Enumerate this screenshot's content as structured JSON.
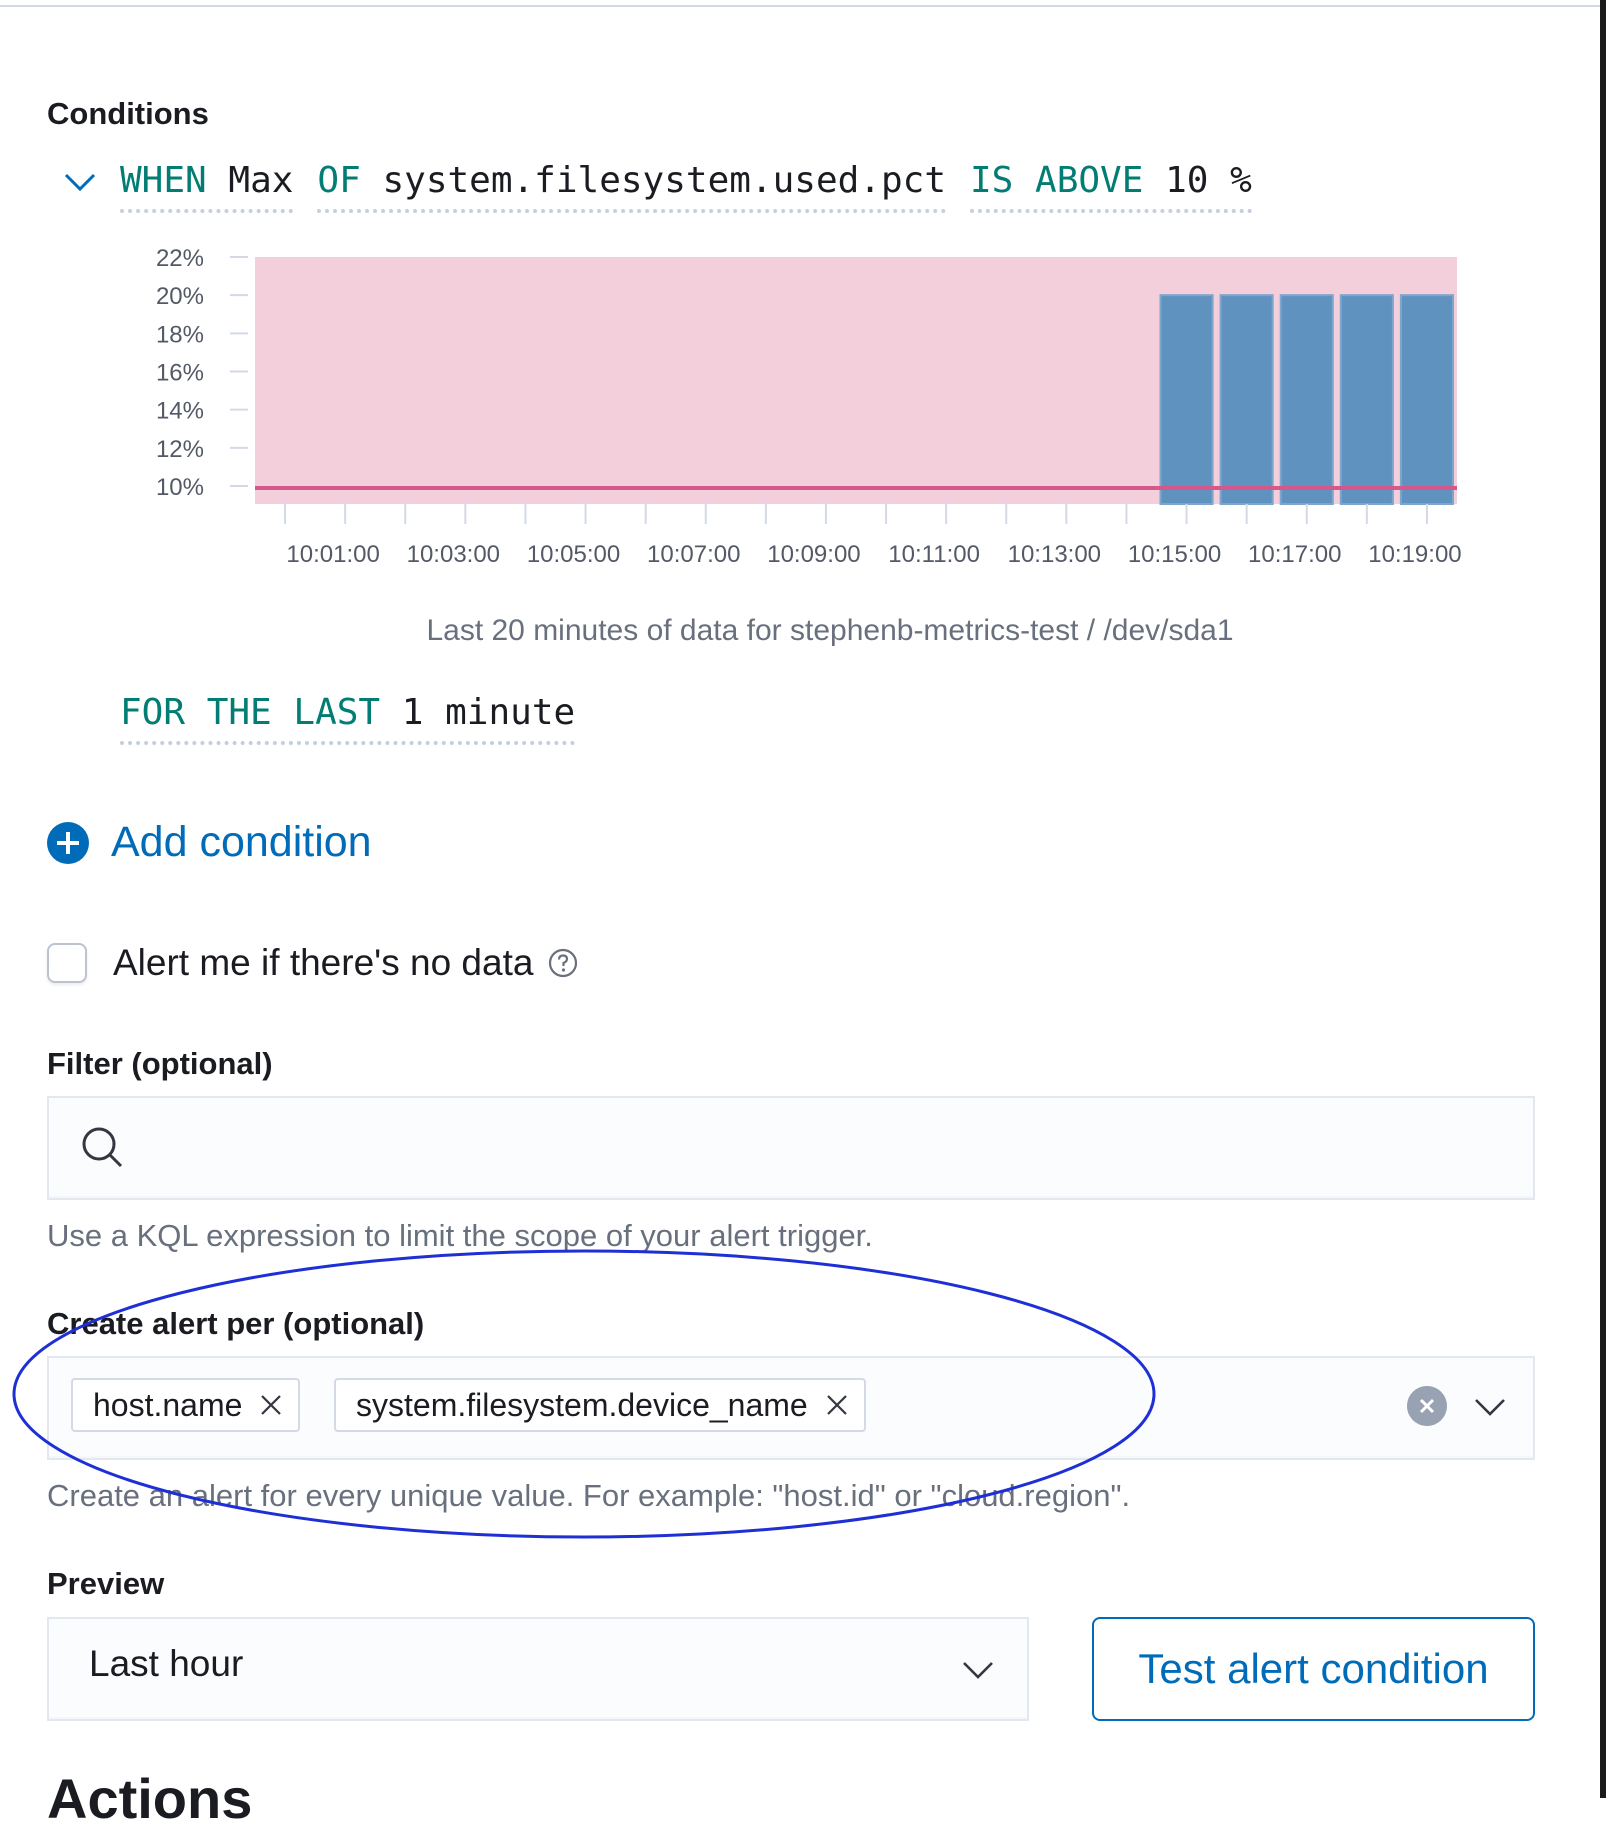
{
  "conditions": {
    "title": "Conditions",
    "expression": {
      "when": "WHEN",
      "aggregation": "Max",
      "of": "OF",
      "metric": "system.filesystem.used.pct",
      "comparator": "IS ABOVE",
      "threshold": "10",
      "unit": "%"
    },
    "for_last": {
      "keyword": "FOR THE LAST",
      "value": "1 minute"
    },
    "add_condition": "Add condition"
  },
  "chart_data": {
    "type": "bar",
    "x_ticks": [
      "10:01:00",
      "10:03:00",
      "10:05:00",
      "10:07:00",
      "10:09:00",
      "10:11:00",
      "10:13:00",
      "10:15:00",
      "10:17:00",
      "10:19:00"
    ],
    "y_ticks": [
      "22%",
      "20%",
      "18%",
      "16%",
      "14%",
      "12%",
      "10%"
    ],
    "ylim": [
      10,
      22
    ],
    "xlim_minutes": [
      0,
      20
    ],
    "threshold": 10,
    "threshold_region": [
      10,
      22
    ],
    "categories": [
      "10:15:00",
      "10:16:00",
      "10:17:00",
      "10:18:00",
      "10:19:00"
    ],
    "values": [
      20,
      20,
      20,
      20,
      20
    ],
    "bar_color": "#6092c0",
    "threshold_color": "#e7664c",
    "region_color": "#f3cfdc",
    "grid": false,
    "caption": "Last 20 minutes of data for stephenb-metrics-test / /dev/sda1"
  },
  "no_data": {
    "label": "Alert me if there's no data",
    "checked": false
  },
  "filter": {
    "label": "Filter (optional)",
    "value": "",
    "helptext": "Use a KQL expression to limit the scope of your alert trigger."
  },
  "group_by": {
    "label": "Create alert per (optional)",
    "pills": [
      "host.name",
      "system.filesystem.device_name"
    ],
    "helptext": "Create an alert for every unique value. For example: \"host.id\" or \"cloud.region\"."
  },
  "preview": {
    "label": "Preview",
    "selected": "Last hour",
    "test_button": "Test alert condition"
  },
  "actions": {
    "title": "Actions"
  },
  "colors": {
    "keyword": "#017d73",
    "link": "#006bb8",
    "annotation": "#1f2fd6"
  }
}
